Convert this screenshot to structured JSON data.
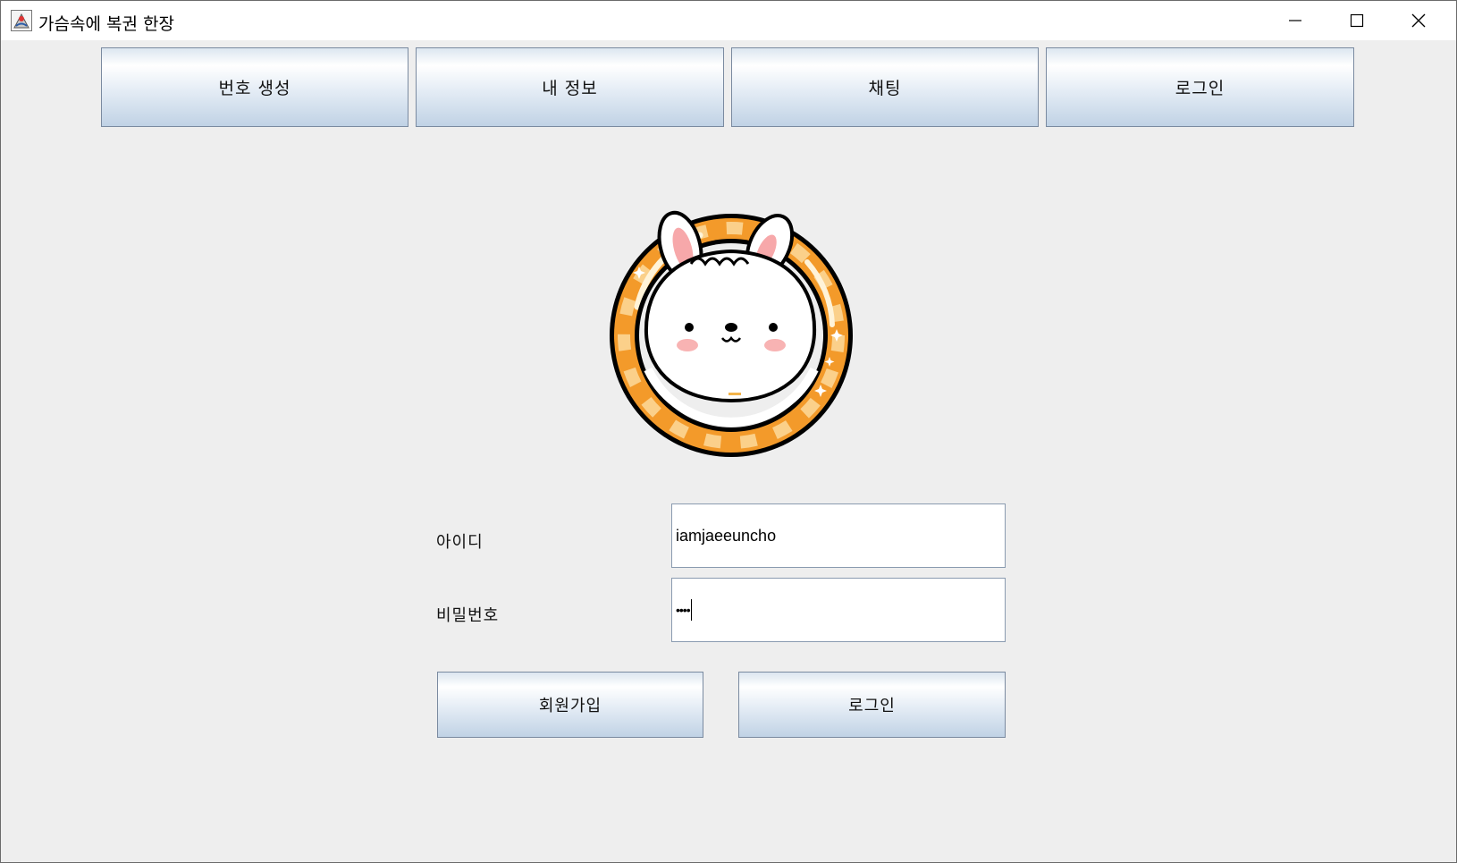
{
  "window": {
    "title": "가슴속에 복권 한장",
    "controls": [
      "minimize-icon",
      "maximize-icon",
      "close-icon"
    ]
  },
  "nav": {
    "items": [
      {
        "label": "번호 생성"
      },
      {
        "label": "내 정보"
      },
      {
        "label": "채팅"
      },
      {
        "label": "로그인"
      }
    ]
  },
  "logo": {
    "icon": "bunny-ring-logo"
  },
  "form": {
    "id_label": "아이디",
    "id_value": "iamjaeeuncho",
    "password_label": "비밀번호",
    "password_value": "••••",
    "signup_label": "회원가입",
    "login_label": "로그인"
  },
  "colors": {
    "background": "#eeeeee",
    "button_top": "#ffffff",
    "button_bottom": "#c0d2e5",
    "ring_orange": "#f39a2a"
  }
}
